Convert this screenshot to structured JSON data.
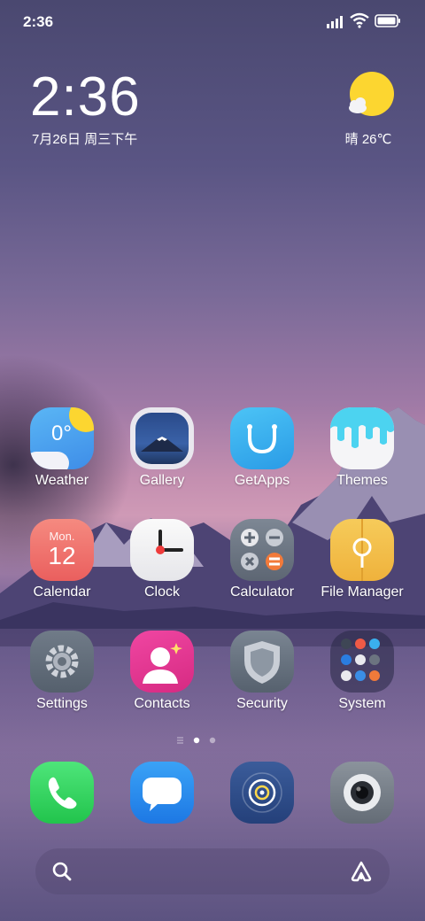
{
  "status_bar": {
    "time": "2:36",
    "icons": [
      "signal-icon",
      "wifi-icon",
      "battery-icon"
    ]
  },
  "clock_widget": {
    "time": "2:36",
    "date": "7月26日 周三下午"
  },
  "weather_widget": {
    "condition": "晴",
    "temperature": "26℃",
    "icon": "sun-icon"
  },
  "apps": [
    {
      "id": "weather",
      "label": "Weather",
      "icon_text": "0°"
    },
    {
      "id": "gallery",
      "label": "Gallery"
    },
    {
      "id": "getapps",
      "label": "GetApps"
    },
    {
      "id": "themes",
      "label": "Themes"
    },
    {
      "id": "calendar",
      "label": "Calendar",
      "month": "Mon.",
      "day": "12"
    },
    {
      "id": "clock",
      "label": "Clock"
    },
    {
      "id": "calculator",
      "label": "Calculator"
    },
    {
      "id": "file-manager",
      "label": "File Manager"
    },
    {
      "id": "settings",
      "label": "Settings"
    },
    {
      "id": "contacts",
      "label": "Contacts"
    },
    {
      "id": "security",
      "label": "Security"
    },
    {
      "id": "system",
      "label": "System"
    }
  ],
  "page_indicator": {
    "pages": 3,
    "current": 2
  },
  "dock": [
    "phone",
    "messaging",
    "browser",
    "camera"
  ],
  "colors": {
    "weather_blue": "#3e8de8",
    "getapps_blue": "#3ab0ee",
    "calendar_red": "#ef6e6a",
    "file_yellow": "#f2c04c",
    "contacts_pink": "#e2368f",
    "phone_green": "#2fd95a",
    "message_blue": "#2a8cf0"
  }
}
